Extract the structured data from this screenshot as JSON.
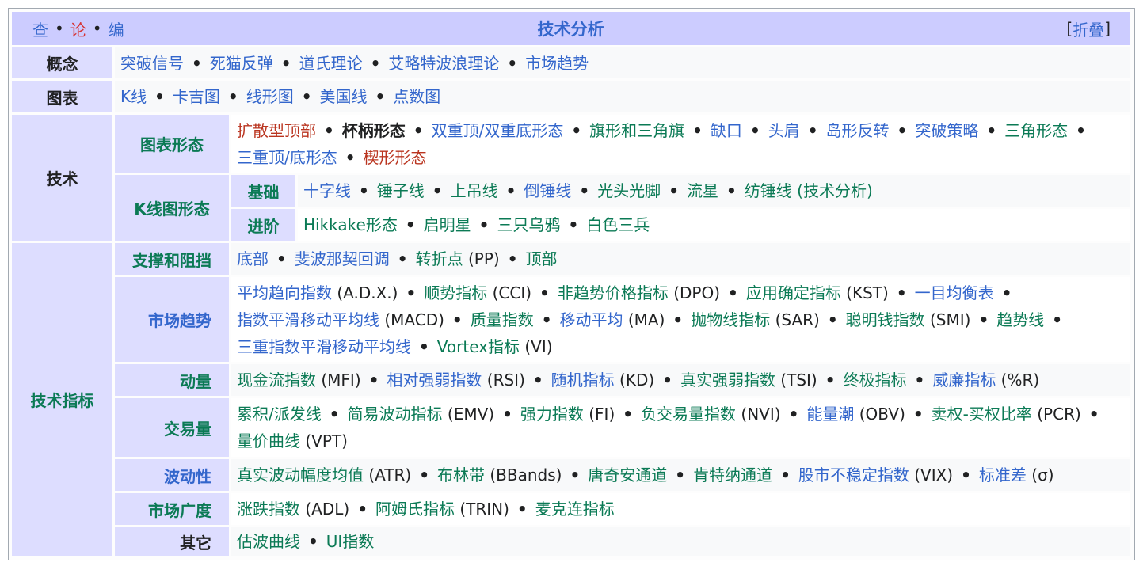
{
  "header": {
    "view": "查",
    "talk": "论",
    "edit": "编",
    "dot": "•",
    "title": "技术分析",
    "collapse_open": "[",
    "collapse": "折叠",
    "collapse_close": "]"
  },
  "groups": {
    "concept": "概念",
    "charts": "图表",
    "technique": "技术",
    "chart_patterns": "图表形态",
    "candle_patterns": "K线图形态",
    "basic": "基础",
    "advanced": "进阶",
    "indicators": "技术指标",
    "support": "支撑和阻挡",
    "trend": "市场趋势",
    "momentum": "动量",
    "volume": "交易量",
    "volatility": "波动性",
    "breadth": "市场广度",
    "other": "其它"
  },
  "lists": {
    "concept": [
      {
        "text": "突破信号",
        "color": "blue"
      },
      {
        "text": "死猫反弹",
        "color": "blue"
      },
      {
        "text": "道氏理论",
        "color": "blue"
      },
      {
        "text": "艾略特波浪理论",
        "color": "blue"
      },
      {
        "text": "市场趋势",
        "color": "blue"
      }
    ],
    "charts": [
      {
        "text": "K线",
        "color": "blue"
      },
      {
        "text": "卡吉图",
        "color": "blue"
      },
      {
        "text": "线形图",
        "color": "blue"
      },
      {
        "text": "美国线",
        "color": "blue"
      },
      {
        "text": "点数图",
        "color": "blue"
      }
    ],
    "chart_patterns": [
      {
        "text": "扩散型顶部",
        "color": "red"
      },
      {
        "text": "杯柄形态",
        "color": "black"
      },
      {
        "text": "双重顶/双重底形态",
        "color": "blue"
      },
      {
        "text": "旗形和三角旗",
        "color": "green"
      },
      {
        "text": "缺口",
        "color": "blue"
      },
      {
        "text": "头肩",
        "color": "blue"
      },
      {
        "text": "岛形反转",
        "color": "blue"
      },
      {
        "text": "突破策略",
        "color": "blue"
      },
      {
        "text": "三角形态",
        "color": "green"
      },
      {
        "text": "三重顶/底形态",
        "color": "blue"
      },
      {
        "text": "楔形形态",
        "color": "red"
      }
    ],
    "basic": [
      {
        "text": "十字线",
        "color": "blue"
      },
      {
        "text": "锤子线",
        "color": "green"
      },
      {
        "text": "上吊线",
        "color": "green"
      },
      {
        "text": "倒锤线",
        "color": "blue"
      },
      {
        "text": "光头光脚",
        "color": "green"
      },
      {
        "text": "流星",
        "color": "green"
      },
      {
        "text": "纺锤线 (技术分析)",
        "color": "green"
      }
    ],
    "advanced": [
      {
        "text": "Hikkake形态",
        "color": "green"
      },
      {
        "text": "启明星",
        "color": "green"
      },
      {
        "text": "三只乌鸦",
        "color": "green"
      },
      {
        "text": "白色三兵",
        "color": "green"
      }
    ],
    "support": [
      {
        "text": "底部",
        "color": "blue"
      },
      {
        "text": "斐波那契回调",
        "color": "blue"
      },
      {
        "text": "转折点",
        "color": "green",
        "extra": " (PP)"
      },
      {
        "text": "顶部",
        "color": "green"
      }
    ],
    "trend": [
      {
        "text": "平均趋向指数",
        "color": "blue",
        "extra": " (A.D.X.)"
      },
      {
        "text": "顺势指标",
        "color": "green",
        "extra": " (CCI)"
      },
      {
        "text": "非趋势价格指标",
        "color": "green",
        "extra": " (DPO)"
      },
      {
        "text": "应用确定指标",
        "color": "green",
        "extra": " (KST)"
      },
      {
        "text": "一目均衡表",
        "color": "blue"
      },
      {
        "text": "指数平滑移动平均线",
        "color": "blue",
        "extra": " (MACD)"
      },
      {
        "text": "质量指数",
        "color": "green"
      },
      {
        "text": "移动平均",
        "color": "blue",
        "extra": " (MA)"
      },
      {
        "text": "抛物线指标",
        "color": "green",
        "extra": " (SAR)"
      },
      {
        "text": "聪明钱指数",
        "color": "green",
        "extra": " (SMI)"
      },
      {
        "text": "趋势线",
        "color": "green"
      },
      {
        "text": "三重指数平滑移动平均线",
        "color": "blue"
      },
      {
        "text": "Vortex指标",
        "color": "green",
        "extra": " (VI)"
      }
    ],
    "momentum": [
      {
        "text": "现金流指数",
        "color": "green",
        "extra": " (MFI)"
      },
      {
        "text": "相对强弱指数",
        "color": "blue",
        "extra": " (RSI)"
      },
      {
        "text": "随机指标",
        "color": "blue",
        "extra": " (KD)"
      },
      {
        "text": "真实强弱指数",
        "color": "green",
        "extra": " (TSI)"
      },
      {
        "text": "终极指标",
        "color": "green"
      },
      {
        "text": "威廉指标",
        "color": "blue",
        "extra": " (%R)"
      }
    ],
    "volume": [
      {
        "text": "累积/派发线",
        "color": "green"
      },
      {
        "text": "简易波动指标",
        "color": "green",
        "extra": " (EMV)"
      },
      {
        "text": "强力指数",
        "color": "green",
        "extra": " (FI)"
      },
      {
        "text": "负交易量指数",
        "color": "green",
        "extra": " (NVI)"
      },
      {
        "text": "能量潮",
        "color": "blue",
        "extra": " (OBV)"
      },
      {
        "text": "卖权-买权比率",
        "color": "green",
        "extra": " (PCR)"
      },
      {
        "text": "量价曲线",
        "color": "green",
        "extra": " (VPT)"
      }
    ],
    "volatility": [
      {
        "text": "真实波动幅度均值",
        "color": "green",
        "extra": " (ATR)"
      },
      {
        "text": "布林带",
        "color": "green",
        "extra": " (BBands)"
      },
      {
        "text": "唐奇安通道",
        "color": "green"
      },
      {
        "text": "肯特纳通道",
        "color": "green"
      },
      {
        "text": "股市不稳定指数",
        "color": "blue",
        "extra": " (VIX)"
      },
      {
        "text": "标准差",
        "color": "blue",
        "extra": " (σ)"
      }
    ],
    "breadth": [
      {
        "text": "涨跌指数",
        "color": "green",
        "extra": " (ADL)"
      },
      {
        "text": "阿姆氏指标",
        "color": "green",
        "extra": " (TRIN)"
      },
      {
        "text": "麦克连指标",
        "color": "green"
      }
    ],
    "other": [
      {
        "text": "估波曲线",
        "color": "green"
      },
      {
        "text": "UI指数",
        "color": "green"
      }
    ]
  }
}
